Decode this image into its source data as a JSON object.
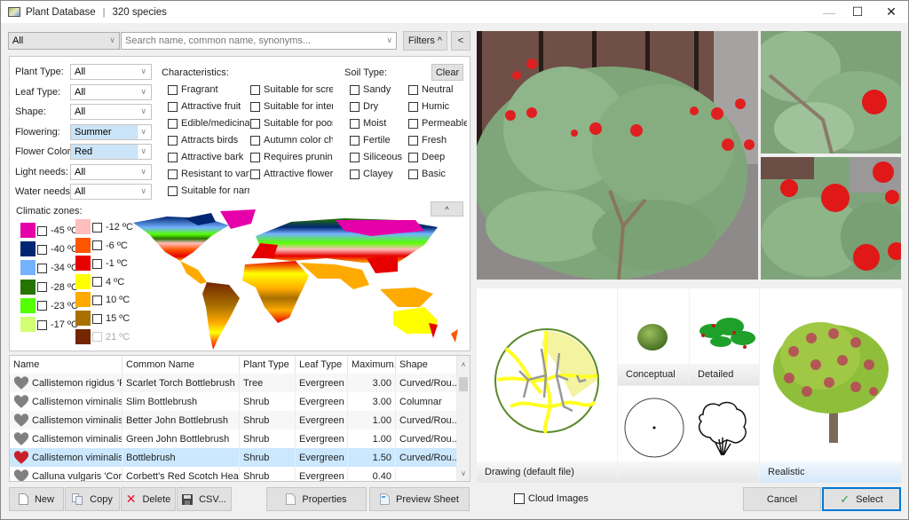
{
  "window": {
    "title": "Plant Database",
    "separator": "|",
    "species_count": "320 species",
    "controls": {
      "minimize": "—",
      "maximize": "☐",
      "close": "✕"
    }
  },
  "search": {
    "category_value": "All",
    "placeholder": "Search name, common name, synonyms...",
    "filters_button": "Filters  ^",
    "collapse_button": "<"
  },
  "filters": {
    "dropdowns": [
      {
        "label": "Plant Type:",
        "value": "All",
        "highlighted": false
      },
      {
        "label": "Leaf Type:",
        "value": "All",
        "highlighted": false
      },
      {
        "label": "Shape:",
        "value": "All",
        "highlighted": false
      },
      {
        "label": "Flowering:",
        "value": "Summer",
        "highlighted": true
      },
      {
        "label": "Flower Color:",
        "value": "Red",
        "highlighted": true
      },
      {
        "label": "Light needs:",
        "value": "All",
        "highlighted": false
      },
      {
        "label": "Water needs:",
        "value": "All",
        "highlighted": false
      }
    ],
    "characteristics_label": "Characteristics:",
    "characteristics_col1": [
      "Fragrant",
      "Attractive fruit",
      "Edible/medicinal f",
      "Attracts birds",
      "Attractive bark",
      "Resistant to vanda",
      "Suitable for narrov"
    ],
    "characteristics_col2": [
      "Suitable for screen",
      "Suitable for interic",
      "Suitable for poor s",
      "Autumn color char",
      "Requires pruning",
      "Attractive flower"
    ],
    "soil_label": "Soil Type:",
    "clear_button": "Clear",
    "soil_col1": [
      "Sandy",
      "Dry",
      "Moist",
      "Fertile",
      "Siliceous",
      "Clayey"
    ],
    "soil_col2": [
      "Neutral",
      "Humic",
      "Permeable",
      "Fresh",
      "Deep",
      "Basic"
    ],
    "climatic_label": "Climatic zones:",
    "collapse_map_button": "^",
    "zones": [
      {
        "label": "-45 ºC",
        "color": "#e600a9",
        "enabled": true
      },
      {
        "label": "-40 ºC",
        "color": "#002673",
        "enabled": true
      },
      {
        "label": "-34 ºC",
        "color": "#73b2ff",
        "enabled": true
      },
      {
        "label": "-28 ºC",
        "color": "#267300",
        "enabled": true
      },
      {
        "label": "-23 ºC",
        "color": "#55ff00",
        "enabled": true
      },
      {
        "label": "-17 ºC",
        "color": "#d1ff73",
        "enabled": true
      },
      {
        "label": "-12 ºC",
        "color": "#ffbebe",
        "enabled": true
      },
      {
        "label": "-6 ºC",
        "color": "#ff5500",
        "enabled": true
      },
      {
        "label": "-1 ºC",
        "color": "#e60000",
        "enabled": true
      },
      {
        "label": "4 ºC",
        "color": "#ffff00",
        "enabled": true
      },
      {
        "label": "10 ºC",
        "color": "#ffaa00",
        "enabled": true
      },
      {
        "label": "15 ºC",
        "color": "#a87000",
        "enabled": true
      },
      {
        "label": "21 ºC",
        "color": "#732600",
        "enabled": false
      }
    ]
  },
  "table": {
    "columns": [
      "Name",
      "Common Name",
      "Plant Type",
      "Leaf Type",
      "Maximum...",
      "Shape"
    ],
    "rows": [
      {
        "favorite": false,
        "name": "Callistemon rigidus 'R...",
        "common": "Scarlet Torch Bottlebrush",
        "type": "Tree",
        "leaf": "Evergreen",
        "max": "3.00",
        "shape": "Curved/Rou..."
      },
      {
        "favorite": false,
        "name": "Callistemon viminalis '...",
        "common": "Slim Bottlebrush",
        "type": "Shrub",
        "leaf": "Evergreen",
        "max": "3.00",
        "shape": "Columnar"
      },
      {
        "favorite": false,
        "name": "Callistemon viminalis '...",
        "common": "Better John Bottlebrush",
        "type": "Shrub",
        "leaf": "Evergreen",
        "max": "1.00",
        "shape": "Curved/Rou..."
      },
      {
        "favorite": false,
        "name": "Callistemon viminalis '...",
        "common": "Green John Bottlebrush",
        "type": "Shrub",
        "leaf": "Evergreen",
        "max": "1.00",
        "shape": "Curved/Rou..."
      },
      {
        "favorite": true,
        "name": "Callistemon viminalis '...",
        "common": "Bottlebrush",
        "type": "Shrub",
        "leaf": "Evergreen",
        "max": "1.50",
        "shape": "Curved/Rou...",
        "selected": true
      },
      {
        "favorite": false,
        "name": "Calluna vulgaris 'Corb...",
        "common": "Corbett's Red Scotch Heather",
        "type": "Shrub",
        "leaf": "Evergreen",
        "max": "0.40",
        "shape": ""
      }
    ]
  },
  "actions": {
    "new": "New",
    "copy": "Copy",
    "delete": "Delete",
    "csv": "CSV...",
    "properties": "Properties",
    "preview": "Preview Sheet",
    "cloud_images": "Cloud Images",
    "cancel": "Cancel",
    "select": "Select"
  },
  "representations": {
    "drawing": "Drawing   (default file)",
    "conceptual": "Conceptual",
    "detailed": "Detailed",
    "realistic": "Realistic"
  },
  "colors": {
    "selection": "#cce8ff",
    "accent": "#0078d7",
    "heart_active": "#c8202a",
    "heart_inactive": "#808080"
  }
}
